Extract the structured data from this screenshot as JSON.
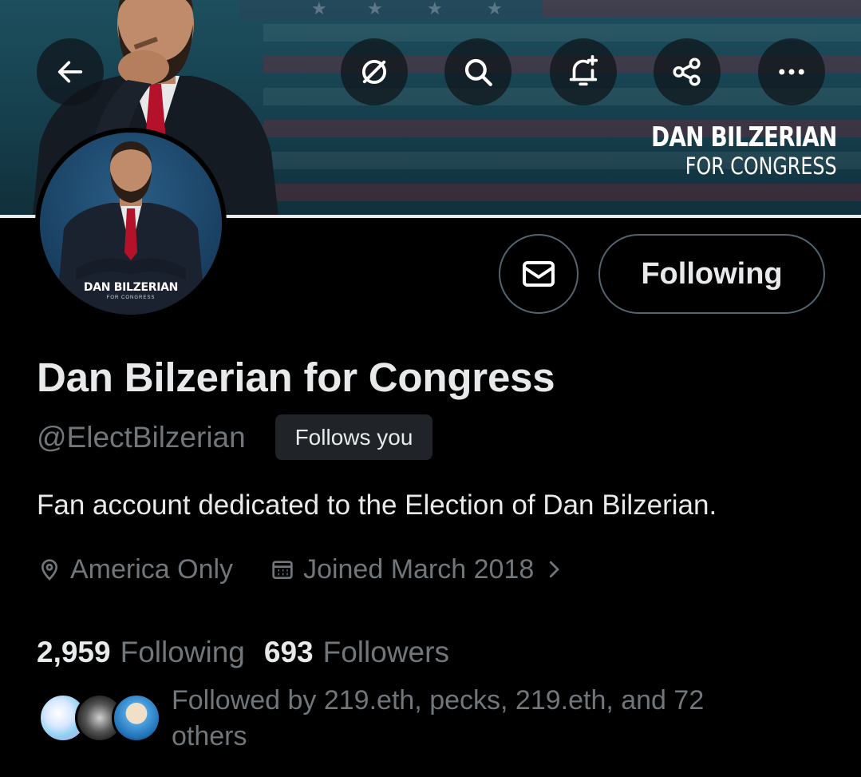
{
  "header": {
    "back_icon": "arrow-left-icon",
    "buttons": [
      "grok-icon",
      "search-icon",
      "notification-add-icon",
      "share-icon",
      "more-icon"
    ]
  },
  "banner": {
    "title": "DAN BILZERIAN",
    "subtitle": "FOR CONGRESS"
  },
  "avatar": {
    "label": "DAN BILZERIAN",
    "sublabel": "FOR CONGRESS"
  },
  "actions": {
    "message_icon": "envelope-icon",
    "follow_label": "Following"
  },
  "profile": {
    "display_name": "Dan Bilzerian for Congress",
    "handle": "@ElectBilzerian",
    "follows_you": "Follows you",
    "bio": "Fan account dedicated to the Election of Dan Bilzerian.",
    "location": "America Only",
    "joined": "Joined March 2018"
  },
  "stats": {
    "following_count": "2,959",
    "following_label": "Following",
    "followers_count": "693",
    "followers_label": "Followers"
  },
  "followed_by": {
    "text": "Followed by 219.eth, pecks, 219.eth, and 72 others"
  },
  "colors": {
    "background": "#000000",
    "text_primary": "#e7e9ea",
    "text_secondary": "#71767b",
    "border": "#536471",
    "badge_bg": "#202327"
  }
}
